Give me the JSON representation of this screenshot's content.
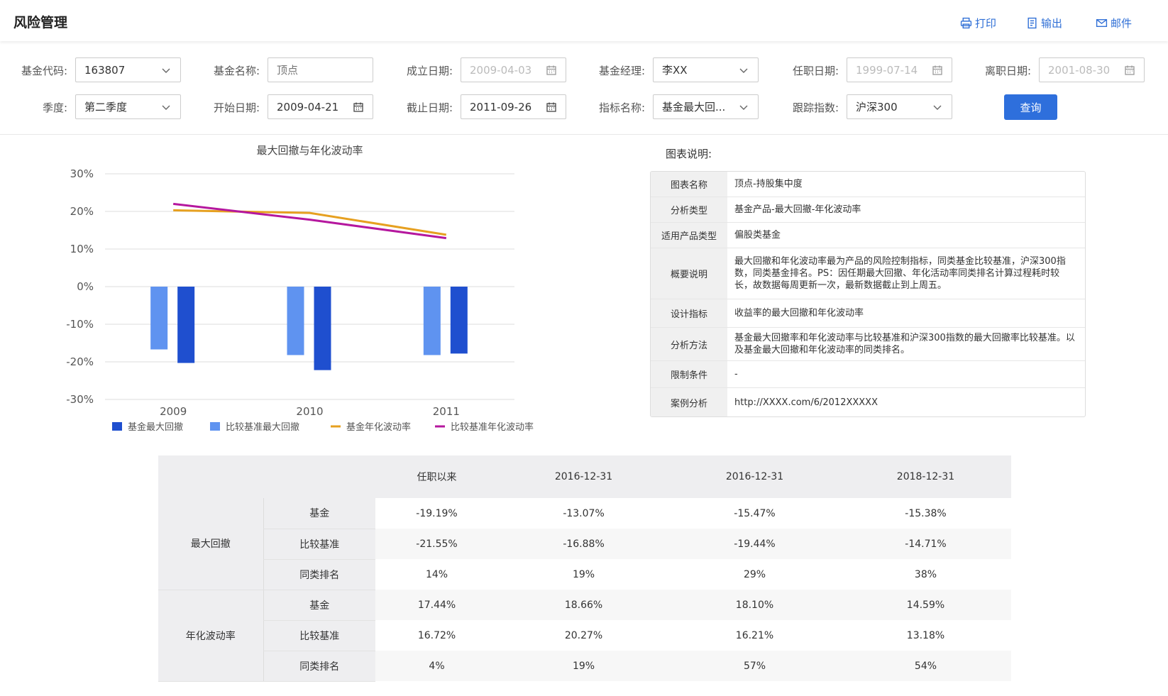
{
  "header": {
    "title": "风险管理",
    "actions": [
      {
        "label": "打印",
        "icon": "printer-icon"
      },
      {
        "label": "输出",
        "icon": "export-icon"
      },
      {
        "label": "邮件",
        "icon": "mail-icon"
      }
    ]
  },
  "filters": {
    "fund_code": {
      "label": "基金代码:",
      "value": "163807"
    },
    "fund_name": {
      "label": "基金名称:",
      "placeholder": "顶点"
    },
    "establish_date": {
      "label": "成立日期:",
      "value": "2009-04-03"
    },
    "manager": {
      "label": "基金经理:",
      "value": "李XX"
    },
    "tenure_date": {
      "label": "任职日期:",
      "value": "1999-07-14"
    },
    "leave_date": {
      "label": "离职日期:",
      "value": "2001-08-30"
    },
    "quarter": {
      "label": "季度:",
      "value": "第二季度"
    },
    "start_date": {
      "label": "开始日期:",
      "value": "2009-04-21"
    },
    "end_date": {
      "label": "截止日期:",
      "value": "2011-09-26"
    },
    "indicator": {
      "label": "指标名称:",
      "value": "基金最大回..."
    },
    "tracking_index": {
      "label": "跟踪指数:",
      "value": "沪深300"
    },
    "query_button": "查询"
  },
  "chart_data": {
    "type": "bar",
    "title": "最大回撤与年化波动率",
    "categories": [
      "2009",
      "2010",
      "2011"
    ],
    "yticks": [
      "30%",
      "20%",
      "10%",
      "0%",
      "-10%",
      "-20%",
      "-30%"
    ],
    "ylim": [
      -30,
      30
    ],
    "series": [
      {
        "name": "基金最大回撤",
        "type": "bar",
        "color": "#1f4fcf",
        "values": [
          -20.3,
          -22.2,
          -17.8
        ]
      },
      {
        "name": "比较基准最大回撤",
        "type": "bar",
        "color": "#5f93f0",
        "values": [
          -16.7,
          -18.2,
          -18.2
        ]
      },
      {
        "name": "基金年化波动率",
        "type": "line",
        "color": "#e6a020",
        "values": [
          20.3,
          19.6,
          13.8
        ]
      },
      {
        "name": "比较基准年化波动率",
        "type": "line",
        "color": "#b5179e",
        "values": [
          22.0,
          17.8,
          12.9
        ]
      }
    ],
    "grid": true,
    "legend": "bottom"
  },
  "explanation": {
    "title": "图表说明:",
    "rows": [
      {
        "key": "图表名称",
        "value": "顶点-持股集中度"
      },
      {
        "key": "分析类型",
        "value": "基金产品-最大回撤-年化波动率"
      },
      {
        "key": "适用产品类型",
        "value": "偏股类基金"
      },
      {
        "key": "概要说明",
        "value": "最大回撤和年化波动率最为产品的风险控制指标，同类基金比较基准，沪深300指数，同类基金排名。PS：因任期最大回撤、年化活动率同类排名计算过程耗时较长，故数据每周更新一次，最新数据截止到上周五。"
      },
      {
        "key": "设计指标",
        "value": "收益率的最大回撤和年化波动率"
      },
      {
        "key": "分析方法",
        "value": "基金最大回撤率和年化波动率与比较基准和沪深300指数的最大回撤率比较基准。以及基金最大回撤和年化波动率的同类排名。"
      },
      {
        "key": "限制条件",
        "value": "-"
      },
      {
        "key": "案例分析",
        "value": "http://XXXX.com/6/2012XXXXX"
      }
    ]
  },
  "table": {
    "columns": [
      "任职以来",
      "2016-12-31",
      "2016-12-31",
      "2018-12-31"
    ],
    "groups": [
      {
        "name": "最大回撤",
        "rows": [
          {
            "label": "基金",
            "values": [
              "-19.19%",
              "-13.07%",
              "-15.47%",
              "-15.38%"
            ]
          },
          {
            "label": "比较基准",
            "values": [
              "-21.55%",
              "-16.88%",
              "-19.44%",
              "-14.71%"
            ]
          },
          {
            "label": "同类排名",
            "values": [
              "14%",
              "19%",
              "29%",
              "38%"
            ]
          }
        ]
      },
      {
        "name": "年化波动率",
        "rows": [
          {
            "label": "基金",
            "values": [
              "17.44%",
              "18.66%",
              "18.10%",
              "14.59%"
            ]
          },
          {
            "label": "比较基准",
            "values": [
              "16.72%",
              "20.27%",
              "16.21%",
              "13.18%"
            ]
          },
          {
            "label": "同类排名",
            "values": [
              "4%",
              "19%",
              "57%",
              "54%"
            ]
          }
        ]
      }
    ]
  }
}
